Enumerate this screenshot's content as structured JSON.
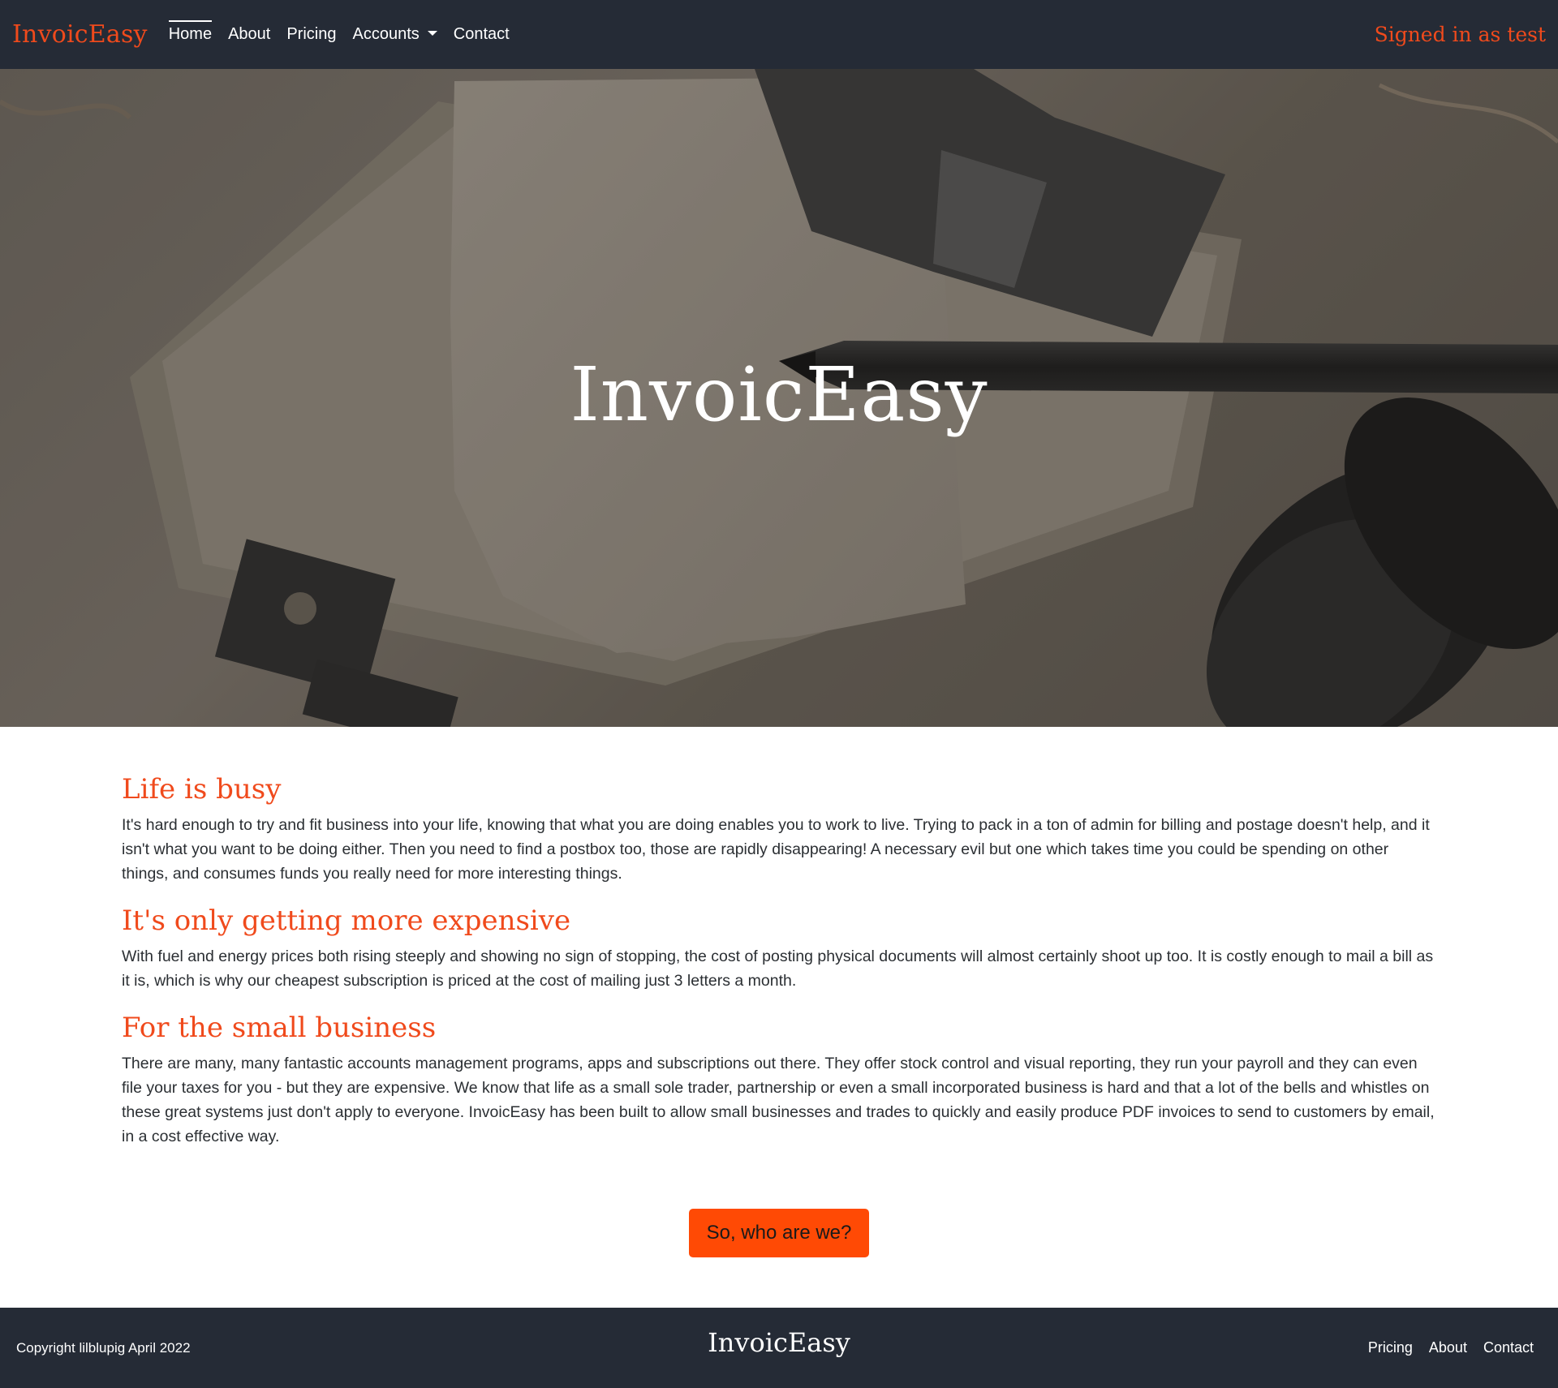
{
  "navbar": {
    "brand": "InvoicEasy",
    "items": [
      {
        "label": "Home",
        "active": true
      },
      {
        "label": "About"
      },
      {
        "label": "Pricing"
      },
      {
        "label": "Accounts",
        "dropdown": true
      },
      {
        "label": "Contact"
      }
    ],
    "signed_in": "Signed in as test"
  },
  "hero": {
    "title": "InvoicEasy"
  },
  "sections": [
    {
      "heading": "Life is busy",
      "body": "It's hard enough to try and fit business into your life, knowing that what you are doing enables you to work to live. Trying to pack in a ton of admin for billing and postage doesn't help, and it isn't what you want to be doing either. Then you need to find a postbox too, those are rapidly disappearing! A necessary evil but one which takes time you could be spending on other things, and consumes funds you really need for more interesting things."
    },
    {
      "heading": "It's only getting more expensive",
      "body": "With fuel and energy prices both rising steeply and showing no sign of stopping, the cost of posting physical documents will almost certainly shoot up too. It is costly enough to mail a bill as it is, which is why our cheapest subscription is priced at the cost of mailing just 3 letters a month."
    },
    {
      "heading": "For the small business",
      "body": "There are many, many fantastic accounts management programs, apps and subscriptions out there. They offer stock control and visual reporting, they run your payroll and they can even file your taxes for you - but they are expensive. We know that life as a small sole trader, partnership or even a small incorporated business is hard and that a lot of the bells and whistles on these great systems just don't apply to everyone. InvoicEasy has been built to allow small businesses and trades to quickly and easily produce PDF invoices to send to customers by email, in a cost effective way."
    }
  ],
  "cta": {
    "label": "So, who are we?"
  },
  "footer": {
    "copyright": "Copyright lilblupig April 2022",
    "brand": "InvoicEasy",
    "links": [
      "Pricing",
      "About",
      "Contact"
    ]
  },
  "colors": {
    "accent": "#f04a1c",
    "button": "#ff4a05",
    "navbar_bg": "#252b36",
    "footer_bg": "#252b36"
  }
}
